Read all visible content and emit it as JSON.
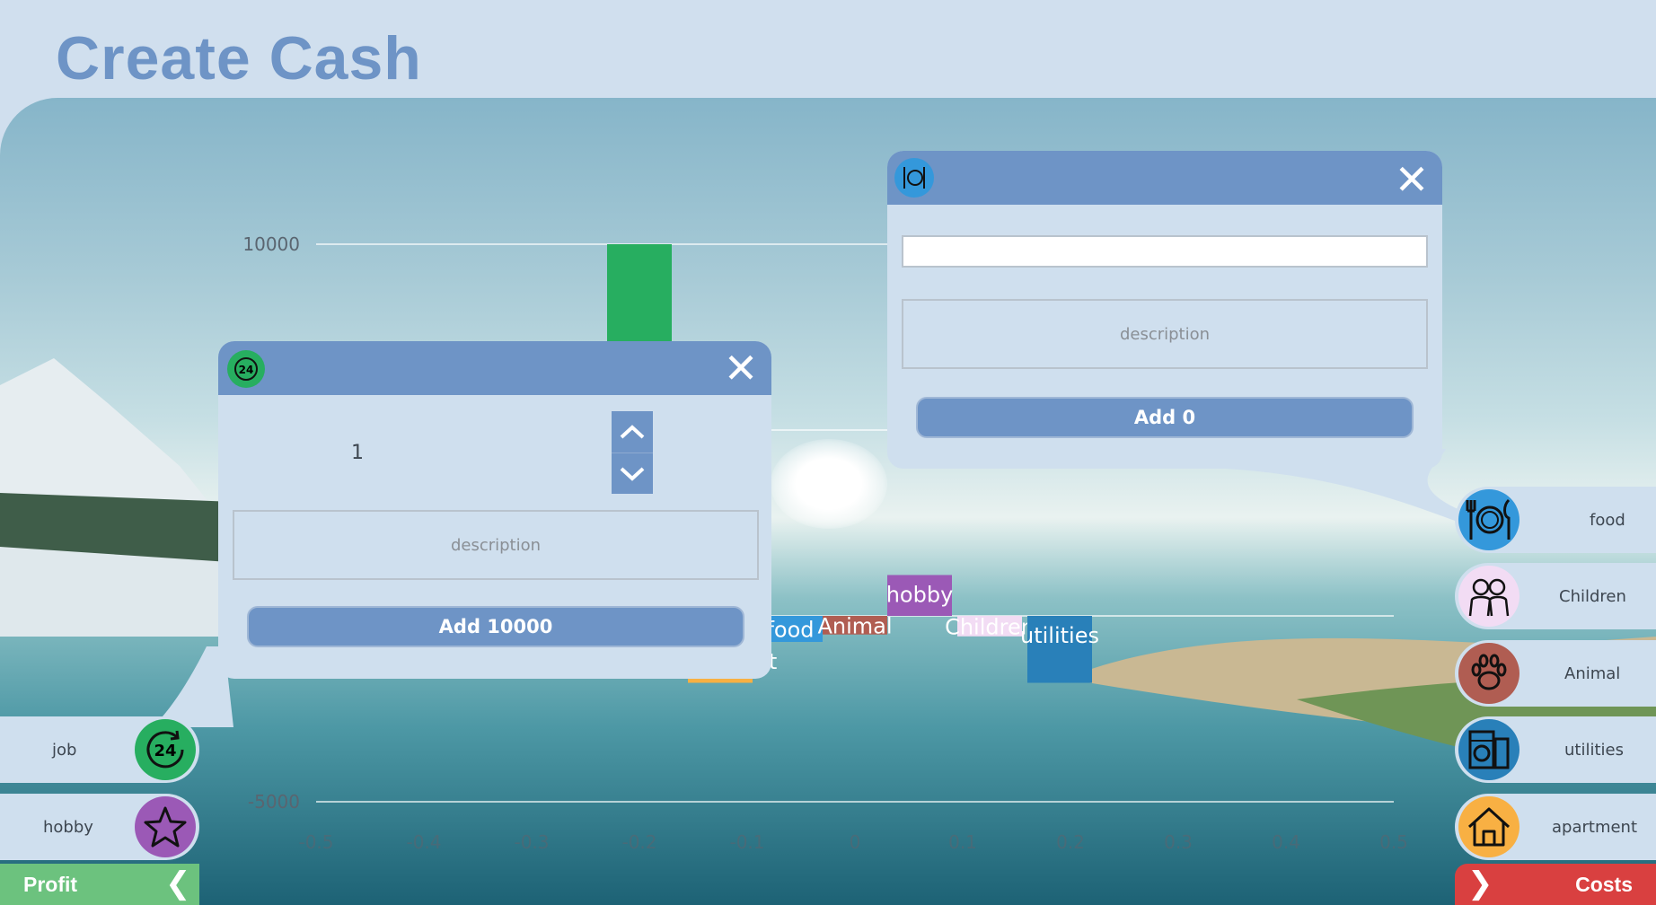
{
  "app": {
    "title": "Create Cash"
  },
  "chart_data": {
    "type": "bar",
    "ylim": [
      -5000,
      10000
    ],
    "xlim": [
      -0.5,
      0.5
    ],
    "y_ticks": [
      "10000",
      "-5000"
    ],
    "x_ticks": [
      "-0.5",
      "-0.4",
      "-0.3",
      "-0.2",
      "-0.1",
      "0",
      "0.1",
      "0.2",
      "0.3",
      "0.4",
      "0.5"
    ],
    "bars": [
      {
        "label": "",
        "x": -0.2,
        "y0": 0,
        "y1": 10000,
        "color": "#27ae60"
      },
      {
        "label": "food",
        "x": -0.06,
        "y0": -700,
        "y1": 0,
        "color": "#3498db"
      },
      {
        "label": "Animal",
        "x": 0.0,
        "y0": -500,
        "y1": 0,
        "color": "#b05d52"
      },
      {
        "label": "hobby",
        "x": 0.06,
        "y0": 0,
        "y1": 1100,
        "color": "#9b59b6"
      },
      {
        "label": "Children",
        "x": 0.125,
        "y0": -550,
        "y1": 0,
        "color": "#f2dcf4"
      },
      {
        "label": "utilities",
        "x": 0.19,
        "y0": -1800,
        "y1": 0,
        "color": "#2980b9"
      },
      {
        "label": "apartment",
        "x": -0.125,
        "y0": -1800,
        "y1": -700,
        "color": "#f8b043"
      }
    ]
  },
  "dialog_income": {
    "icon": "24-hours-icon",
    "value": "1",
    "description_placeholder": "description",
    "add_label": "Add 10000",
    "close_label": "✕"
  },
  "dialog_expense": {
    "icon": "plate-cutlery-icon",
    "input_value": "",
    "description_placeholder": "description",
    "add_label": "Add 0",
    "close_label": "✕"
  },
  "income_categories": [
    {
      "label": "job",
      "icon": "24-hours-icon",
      "color": "#27ae60"
    },
    {
      "label": "hobby",
      "icon": "star-icon",
      "color": "#9b59b6"
    }
  ],
  "expense_categories": [
    {
      "label": "food",
      "icon": "plate-cutlery-icon",
      "color": "#3498db"
    },
    {
      "label": "Children",
      "icon": "children-icon",
      "color": "#f2dcf4"
    },
    {
      "label": "Animal",
      "icon": "paw-icon",
      "color": "#b05d52"
    },
    {
      "label": "utilities",
      "icon": "washing-machine-icon",
      "color": "#2980b9"
    },
    {
      "label": "apartment",
      "icon": "house-icon",
      "color": "#f8b043"
    }
  ],
  "footer": {
    "profit_label": "Profit",
    "profit_color": "#6cc27e",
    "profit_arrow": "❮",
    "costs_label": "Costs",
    "costs_color": "#d94040",
    "costs_arrow": "❯"
  }
}
